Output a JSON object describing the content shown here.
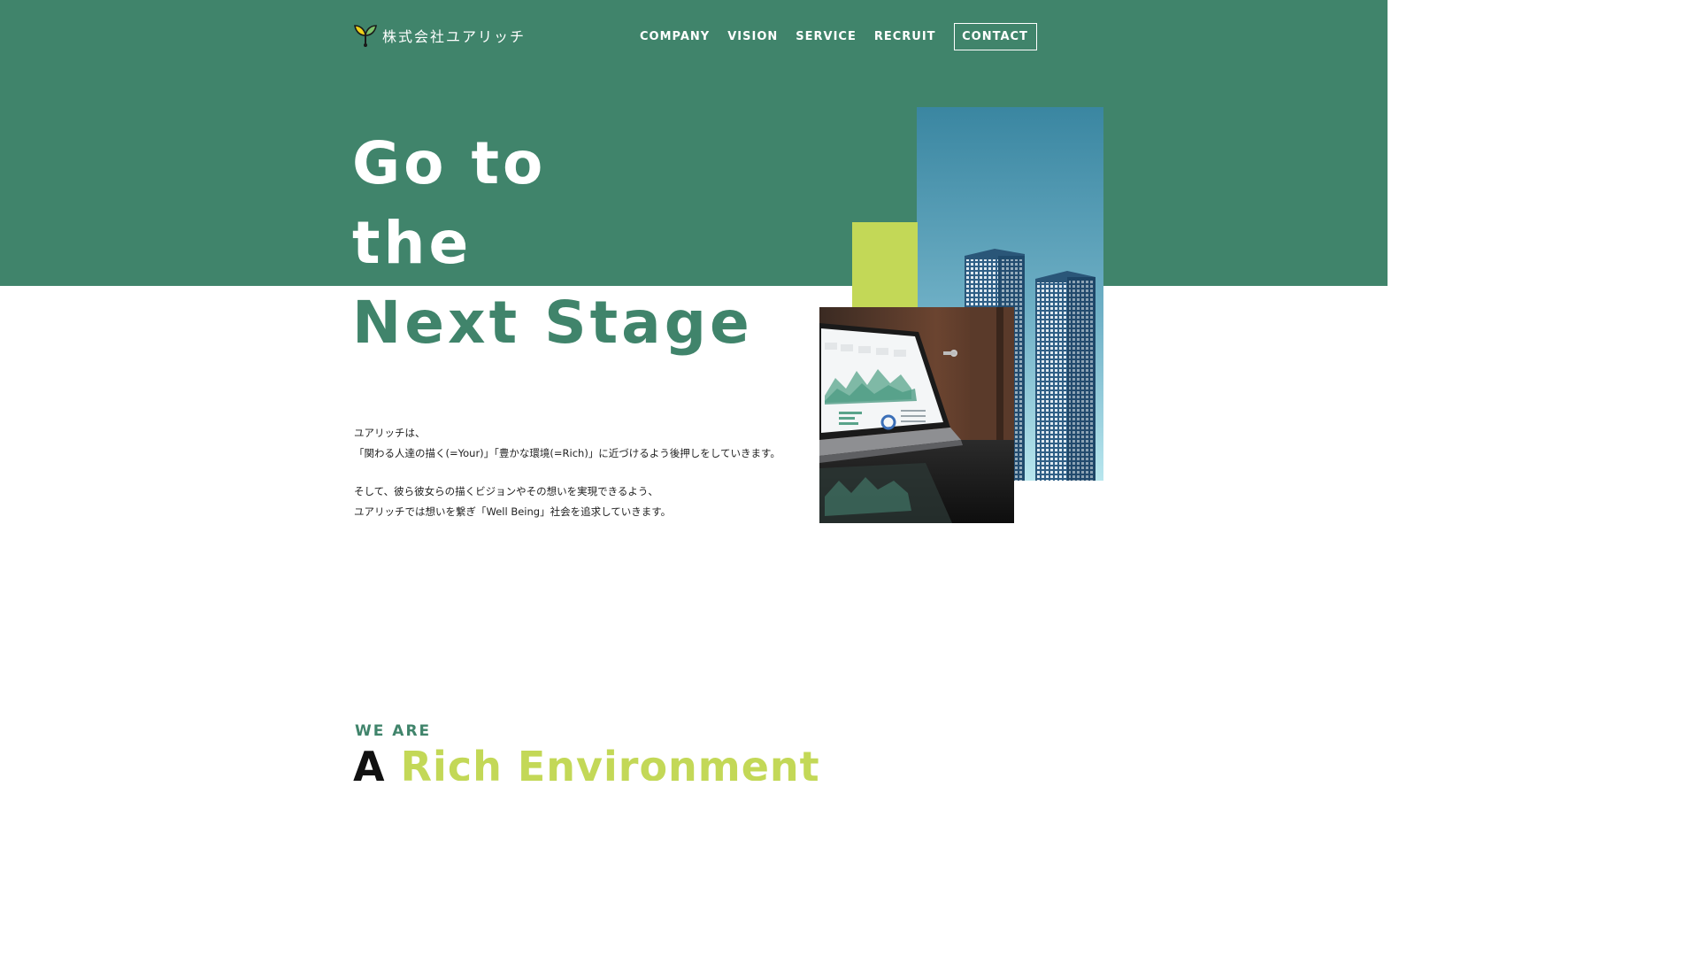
{
  "header": {
    "logo_text": "株式会社ユアリッチ",
    "nav": [
      "COMPANY",
      "VISION",
      "SERVICE",
      "RECRUIT"
    ],
    "contact_label": "CONTACT"
  },
  "hero": {
    "headline_line1": "Go to",
    "headline_line2": "the",
    "headline_line3": "Next Stage",
    "intro_lines": [
      "ユアリッチは、",
      "「関わる人達の描く(=Your)」「豊かな環境(=Rich)」に近づけるよう後押しをしていきます。",
      "そして、彼ら彼女らの描くビジョンやその想いを実現できるよう、",
      "ユアリッチでは想いを繋ぎ「Well Being」社会を追求していきます。"
    ],
    "images": {
      "city": "city-skyscrapers-photo",
      "laptop": "laptop-analytics-photo"
    }
  },
  "section": {
    "eyebrow": "WE ARE",
    "title_prefix": "A",
    "title_highlight": "Rich Environment"
  },
  "colors": {
    "brand_green": "#40846b",
    "accent_lime": "#c3d857",
    "text_dark": "#222222"
  }
}
